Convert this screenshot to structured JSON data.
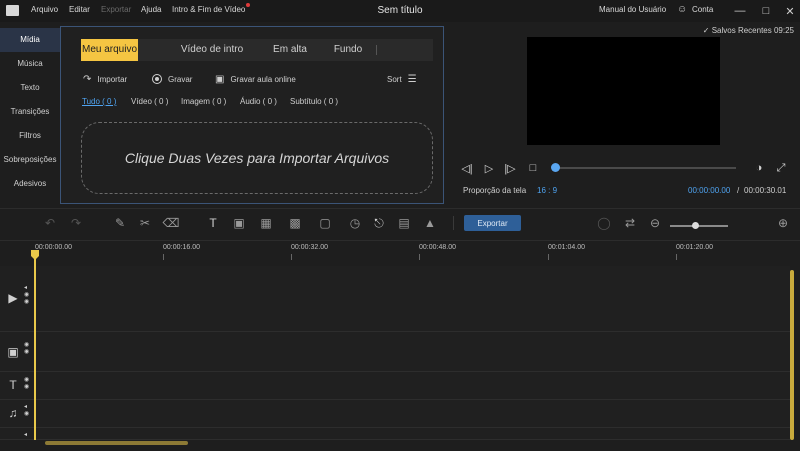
{
  "menu": {
    "items": [
      "Arquivo",
      "Editar",
      "Exportar",
      "Ajuda",
      "Intro & Fim de Vídeo"
    ],
    "window_title": "Sem título",
    "manual": "Manual do Usuário",
    "account": "Conta"
  },
  "sidebar": {
    "items": [
      "Mídia",
      "Música",
      "Texto",
      "Transições",
      "Filtros",
      "Sobreposições",
      "Adesivos"
    ]
  },
  "media": {
    "tabs": [
      "Meu arquivo",
      "Vídeo de intro",
      "Em alta",
      "Fundo"
    ],
    "tools": {
      "import": "Importar",
      "record": "Gravar",
      "record_online": "Gravar aula online",
      "sort": "Sort"
    },
    "filters": [
      "Tudo ( 0 )",
      "Vídeo ( 0 )",
      "Imagem ( 0 )",
      "Áudio ( 0 )",
      "Subtítulo ( 0 )"
    ],
    "dropzone_text": "Clique Duas Vezes para Importar Arquivos"
  },
  "preview": {
    "saved": "Salvos Recentes 09:25",
    "aspect_label": "Proporção da tela",
    "aspect_value": "16 : 9",
    "time_current": "00:00:00.00",
    "time_separator": "/",
    "time_total": "00:00:30.01",
    "progress": 0
  },
  "toolbar": {
    "export_label": "Exportar"
  },
  "timeline": {
    "ruler": [
      "00:00:00.00",
      "00:00:16.00",
      "00:00:32.00",
      "00:00:48.00",
      "00:01:04.00",
      "00:01:20.00"
    ]
  },
  "colors": {
    "accent": "#f5c542",
    "link": "#4fa3f0",
    "export_button": "#2e5f98",
    "playhead": "#e8c84a"
  }
}
